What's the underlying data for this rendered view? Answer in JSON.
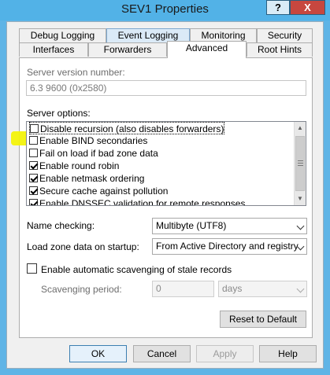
{
  "window": {
    "title": "SEV1 Properties",
    "help_glyph": "?",
    "close_glyph": "X"
  },
  "tabs": {
    "debug_logging": "Debug Logging",
    "event_logging": "Event Logging",
    "monitoring": "Monitoring",
    "security": "Security",
    "interfaces": "Interfaces",
    "forwarders": "Forwarders",
    "advanced": "Advanced",
    "root_hints": "Root Hints"
  },
  "advanced": {
    "server_version_label": "Server version number:",
    "server_version_value": "6.3 9600 (0x2580)",
    "server_options_label": "Server options:",
    "options": [
      {
        "label": "Disable recursion (also disables forwarders)",
        "checked": false
      },
      {
        "label": "Enable BIND secondaries",
        "checked": false
      },
      {
        "label": "Fail on load if bad zone data",
        "checked": false
      },
      {
        "label": "Enable round robin",
        "checked": true
      },
      {
        "label": "Enable netmask ordering",
        "checked": true
      },
      {
        "label": "Secure cache against pollution",
        "checked": true
      },
      {
        "label": "Enable DNSSEC validation for remote responses",
        "checked": true
      }
    ],
    "name_checking_label": "Name checking:",
    "name_checking_value": "Multibyte (UTF8)",
    "load_zone_label": "Load zone data on startup:",
    "load_zone_value": "From Active Directory and registry",
    "auto_scavenging_label": "Enable automatic scavenging of stale records",
    "auto_scavenging_checked": false,
    "scavenging_period_label": "Scavenging period:",
    "scavenging_period_value": "0",
    "scavenging_unit_value": "days",
    "reset_label": "Reset to Default"
  },
  "footer": {
    "ok_label": "OK",
    "cancel_label": "Cancel",
    "apply_label": "Apply",
    "help_label": "Help"
  },
  "colors": {
    "title_bar": "#52b2e7",
    "close_button": "#c7473f",
    "highlighter": "#f3f30a"
  }
}
